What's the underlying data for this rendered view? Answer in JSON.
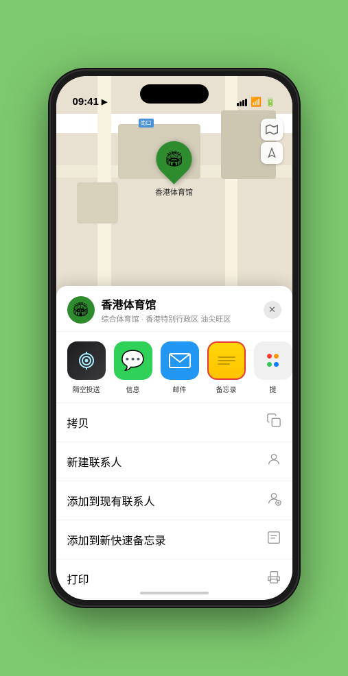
{
  "status_bar": {
    "time": "09:41",
    "time_icon": "▶"
  },
  "map": {
    "label_tag": "南口",
    "venue_pin": "🏟",
    "venue_pin_label": "香港体育馆",
    "controls": {
      "map_icon": "🗺",
      "location_icon": "➤"
    }
  },
  "bottom_sheet": {
    "venue_name": "香港体育馆",
    "venue_sub": "综合体育馆 · 香港特别行政区 油尖旺区",
    "close_label": "✕",
    "share_items": [
      {
        "id": "airdrop",
        "emoji": "📡",
        "label": "隔空投送"
      },
      {
        "id": "messages",
        "emoji": "💬",
        "label": "信息"
      },
      {
        "id": "mail",
        "emoji": "✉",
        "label": "邮件"
      },
      {
        "id": "notes",
        "emoji": "",
        "label": "备忘录"
      },
      {
        "id": "more",
        "emoji": "",
        "label": "提"
      }
    ],
    "actions": [
      {
        "id": "copy",
        "label": "拷贝",
        "icon": "📋"
      },
      {
        "id": "new-contact",
        "label": "新建联系人",
        "icon": "👤"
      },
      {
        "id": "add-contact",
        "label": "添加到现有联系人",
        "icon": "👤"
      },
      {
        "id": "quick-note",
        "label": "添加到新快速备忘录",
        "icon": "📝"
      },
      {
        "id": "print",
        "label": "打印",
        "icon": "🖨"
      }
    ]
  }
}
